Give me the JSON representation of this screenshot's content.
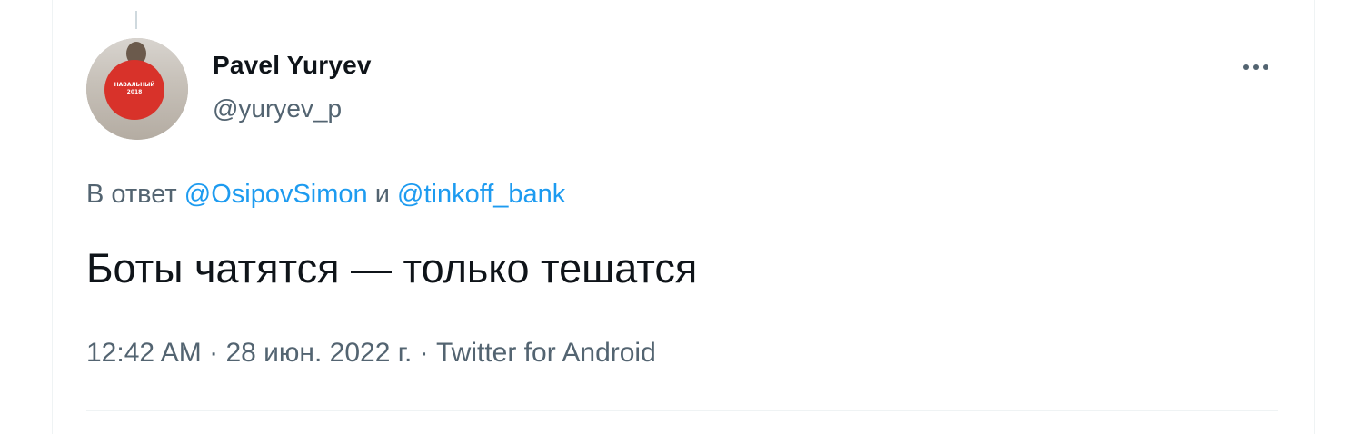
{
  "author": {
    "name": "Pavel Yuryev",
    "handle": "@yuryev_p",
    "avatar_text": "НАВАЛЬНЫЙ\n2018"
  },
  "reply": {
    "prefix": "В ответ ",
    "mention1": "@OsipovSimon",
    "joiner": " и ",
    "mention2": "@tinkoff_bank"
  },
  "tweet": {
    "text": "Боты чатятся — только тешатся"
  },
  "meta": {
    "time": "12:42 AM",
    "separator1": " · ",
    "date": "28 июн. 2022 г.",
    "separator2": " · ",
    "source": "Twitter for Android"
  },
  "icons": {
    "more": "more-horizontal-icon"
  },
  "colors": {
    "accent": "#1d9bf0",
    "text_primary": "#0f1419",
    "text_secondary": "#536471"
  }
}
